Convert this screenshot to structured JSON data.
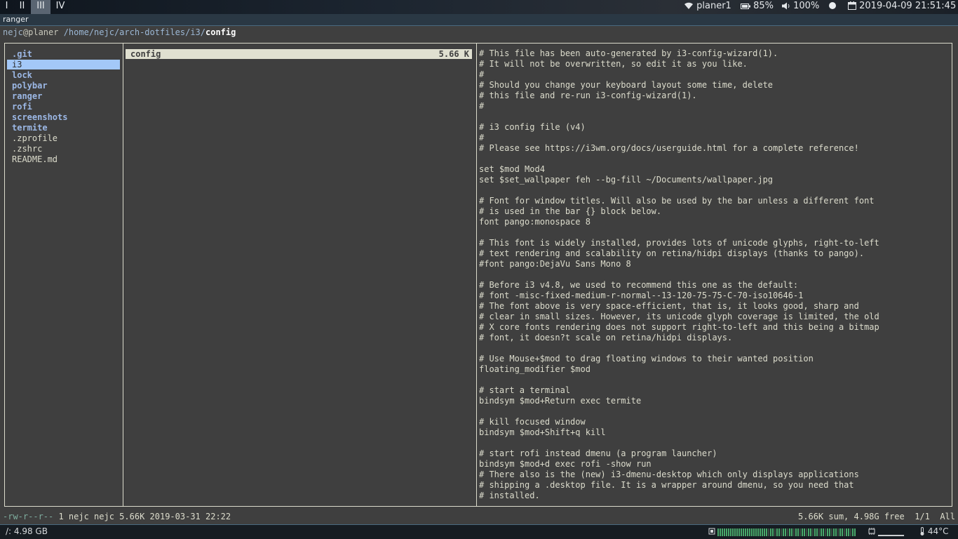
{
  "topbar": {
    "workspaces": [
      "I",
      "II",
      "III",
      "IV"
    ],
    "active_workspace": "III",
    "wifi": {
      "icon": "wifi-icon",
      "ssid": "planer1"
    },
    "battery": {
      "icon": "battery-icon",
      "level": "85%"
    },
    "volume": {
      "icon": "volume-icon",
      "level": "100%"
    },
    "status_dot": {
      "icon": "circle-icon"
    },
    "datetime": {
      "icon": "calendar-icon",
      "value": "2019-04-09 21:51:45"
    }
  },
  "window": {
    "title": "ranger"
  },
  "ranger": {
    "path": {
      "user": "nejc",
      "host": "@planer",
      "dir": " /home/nejc/arch-dotfiles/i3/",
      "file": "config"
    },
    "parent_entries": [
      {
        "name": ".git",
        "kind": "dir"
      },
      {
        "name": "i3",
        "kind": "dir",
        "selected": true
      },
      {
        "name": "lock",
        "kind": "dir"
      },
      {
        "name": "polybar",
        "kind": "dir"
      },
      {
        "name": "ranger",
        "kind": "dir"
      },
      {
        "name": "rofi",
        "kind": "dir"
      },
      {
        "name": "screenshots",
        "kind": "dir"
      },
      {
        "name": "termite",
        "kind": "dir"
      },
      {
        "name": ".zprofile",
        "kind": "file"
      },
      {
        "name": ".zshrc",
        "kind": "file"
      },
      {
        "name": "README.md",
        "kind": "file"
      }
    ],
    "current_entries": [
      {
        "name": "config",
        "size": "5.66 K"
      }
    ],
    "preview_lines": [
      "# This file has been auto-generated by i3-config-wizard(1).",
      "# It will not be overwritten, so edit it as you like.",
      "#",
      "# Should you change your keyboard layout some time, delete",
      "# this file and re-run i3-config-wizard(1).",
      "#",
      "",
      "# i3 config file (v4)",
      "#",
      "# Please see https://i3wm.org/docs/userguide.html for a complete reference!",
      "",
      "set $mod Mod4",
      "set $set_wallpaper feh --bg-fill ~/Documents/wallpaper.jpg",
      "",
      "# Font for window titles. Will also be used by the bar unless a different font",
      "# is used in the bar {} block below.",
      "font pango:monospace 8",
      "",
      "# This font is widely installed, provides lots of unicode glyphs, right-to-left",
      "# text rendering and scalability on retina/hidpi displays (thanks to pango).",
      "#font pango:DejaVu Sans Mono 8",
      "",
      "# Before i3 v4.8, we used to recommend this one as the default:",
      "# font -misc-fixed-medium-r-normal--13-120-75-75-C-70-iso10646-1",
      "# The font above is very space-efficient, that is, it looks good, sharp and",
      "# clear in small sizes. However, its unicode glyph coverage is limited, the old",
      "# X core fonts rendering does not support right-to-left and this being a bitmap",
      "# font, it doesn?t scale on retina/hidpi displays.",
      "",
      "# Use Mouse+$mod to drag floating windows to their wanted position",
      "floating_modifier $mod",
      "",
      "# start a terminal",
      "bindsym $mod+Return exec termite",
      "",
      "# kill focused window",
      "bindsym $mod+Shift+q kill",
      "",
      "# start rofi instead dmenu (a program launcher)",
      "bindsym $mod+d exec rofi -show run",
      "# There also is the (new) i3-dmenu-desktop which only displays applications",
      "# shipping a .desktop file. It is a wrapper around dmenu, so you need that",
      "# installed."
    ],
    "status": {
      "perms": "-rw-r--r--",
      "info": " 1 nejc nejc 5.66K 2019-03-31 22:22",
      "right": "5.66K sum, 4.98G free  1/1  All"
    }
  },
  "bottombar": {
    "disk": "/: 4.98 GB",
    "cpu_icon": "cpu-icon",
    "memory_icon": "memory-icon",
    "memory_value": "▁▁▁▁",
    "temp_icon": "thermometer-icon",
    "temperature": "44°C",
    "colors": {
      "cpu_bar": "#48a86a"
    }
  }
}
